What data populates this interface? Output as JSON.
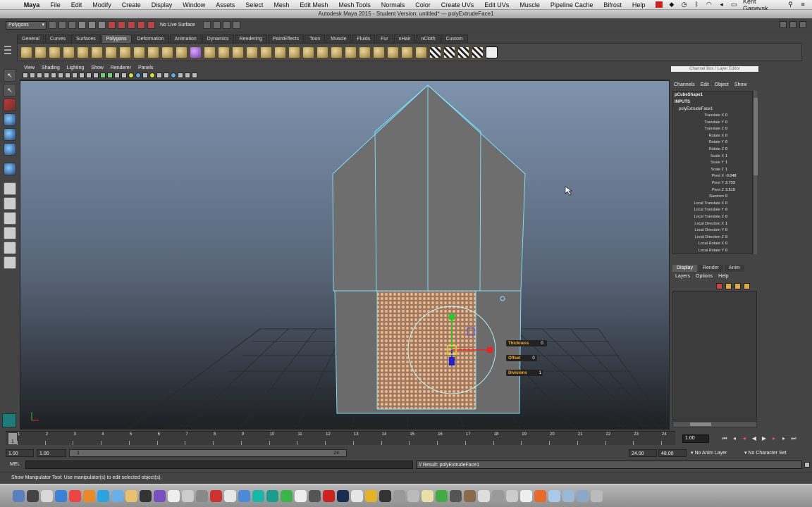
{
  "mac_menu": {
    "apple": "",
    "items": [
      "Maya",
      "File",
      "Edit",
      "Modify",
      "Create",
      "Display",
      "Window",
      "Assets",
      "Select",
      "Mesh",
      "Edit Mesh",
      "Mesh Tools",
      "Normals",
      "Color",
      "Create UVs",
      "Edit UVs",
      "Muscle",
      "Pipeline Cache",
      "Bifrost",
      "Help"
    ],
    "user": "Kent Ganevsk"
  },
  "window_title": "Autodesk Maya 2015 - Student Version: untitled*   ---   polyExtrudeFace1",
  "status_line": {
    "mode": "Polygons",
    "live_surface": "No Live Surface"
  },
  "shelf": {
    "tabs": [
      "General",
      "Curves",
      "Surfaces",
      "Polygons",
      "Deformation",
      "Animation",
      "Dynamics",
      "Rendering",
      "PaintEffects",
      "Toon",
      "Muscle",
      "Fluids",
      "Fur",
      "nHair",
      "nCloth",
      "Custom"
    ],
    "active_tab": "Polygons"
  },
  "panel_menu": [
    "View",
    "Shading",
    "Lighting",
    "Show",
    "Renderer",
    "Panels"
  ],
  "hud": {
    "thickness_label": "Thickness",
    "thickness_value": "0",
    "offset_label": "Offset",
    "offset_value": "0",
    "divisions_label": "Divisions",
    "divisions_value": "1"
  },
  "channel_box": {
    "header": "Channel Box / Layer Editor",
    "tabs": [
      "Channels",
      "Edit",
      "Object",
      "Show"
    ],
    "node": "pCubeShape1",
    "inputs_label": "INPUTS",
    "input_node": "polyExtrudeFace1",
    "attributes": [
      {
        "name": "Translate X",
        "value": "0"
      },
      {
        "name": "Translate Y",
        "value": "0"
      },
      {
        "name": "Translate Z",
        "value": "0"
      },
      {
        "name": "Rotate X",
        "value": "0"
      },
      {
        "name": "Rotate Y",
        "value": "0"
      },
      {
        "name": "Rotate Z",
        "value": "0"
      },
      {
        "name": "Scale X",
        "value": "1"
      },
      {
        "name": "Scale Y",
        "value": "1"
      },
      {
        "name": "Scale Z",
        "value": "1"
      },
      {
        "name": "Pivot X",
        "value": "-0.048"
      },
      {
        "name": "Pivot Y",
        "value": "3.733"
      },
      {
        "name": "Pivot Z",
        "value": "3.519"
      },
      {
        "name": "Random",
        "value": "0"
      },
      {
        "name": "Local Translate X",
        "value": "0"
      },
      {
        "name": "Local Translate Y",
        "value": "0"
      },
      {
        "name": "Local Translate Z",
        "value": "0"
      },
      {
        "name": "Local Direction X",
        "value": "1"
      },
      {
        "name": "Local Direction Y",
        "value": "0"
      },
      {
        "name": "Local Direction Z",
        "value": "0"
      },
      {
        "name": "Local Rotate X",
        "value": "0"
      },
      {
        "name": "Local Rotate Y",
        "value": "0"
      }
    ]
  },
  "layer_editor": {
    "tabs": [
      "Display",
      "Render",
      "Anim"
    ],
    "active_tab": "Display",
    "menu": [
      "Layers",
      "Options",
      "Help"
    ]
  },
  "time_slider": {
    "ticks": [
      "1",
      "2",
      "3",
      "4",
      "5",
      "6",
      "7",
      "8",
      "9",
      "10",
      "11",
      "12",
      "13",
      "14",
      "15",
      "16",
      "17",
      "18",
      "19",
      "20",
      "21",
      "22",
      "23",
      "24"
    ],
    "current_frame_marker": "1",
    "current_time": "1.00"
  },
  "range_slider": {
    "start_time": "1.00",
    "playback_start": "1.00",
    "range_lo": "1",
    "range_hi": "24",
    "playback_end": "24.00",
    "end_time": "48.00",
    "anim_layer": "No Anim Layer",
    "character_set": "No Character Set"
  },
  "command_line": {
    "label": "MEL",
    "result": "// Result: polyExtrudeFace1"
  },
  "help_line": "Show Manipulator Tool: Use manipulator(s) to edit selected object(s).",
  "colors": {
    "wireframe": "#7fe6ff",
    "mesh": "#6e6e6e",
    "selected_face": "#e6a37a"
  }
}
